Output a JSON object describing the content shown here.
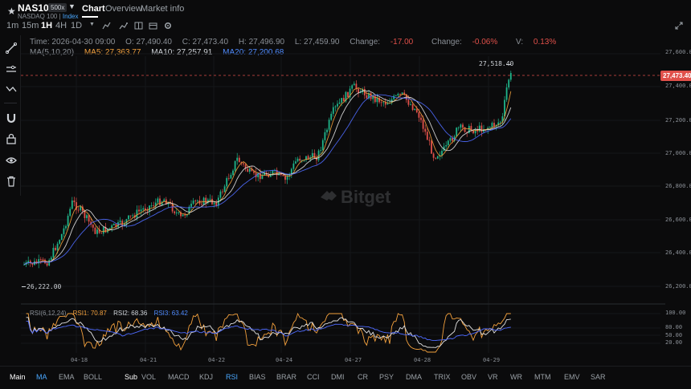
{
  "header": {
    "symbol": "NAS100",
    "leverage_badge": "500x",
    "subtitle": "NASDAQ 100",
    "subtitle_index": "Index",
    "tabs": [
      "Chart",
      "Overview",
      "Market info"
    ],
    "active_tab": "Chart"
  },
  "toolbar": {
    "timeframes": [
      "1m",
      "15m",
      "1H",
      "4H",
      "1D"
    ],
    "active_timeframe": "1H",
    "icons": [
      "chevron-down-icon",
      "indicator-icon",
      "compare-icon",
      "layout-icon",
      "calendar-icon",
      "settings-icon"
    ]
  },
  "ohlc": {
    "time": "Time: 2026-04-30 09:00",
    "open": "O: 27,490.40",
    "close": "C: 27,473.40",
    "high": "H: 27,496.90",
    "low": "L: 27,459.90",
    "change_label": "Change:",
    "change_value": "-17.00",
    "change_pct_label": "Change:",
    "change_pct_value": "-0.06%",
    "volatility_label": "V:",
    "volatility_value": "0.13%"
  },
  "ma": {
    "label": "MA(5,10,20)",
    "ma5": "MA5: 27,363.77",
    "ma10": "MA10: 27,257.91",
    "ma20": "MA20: 27,200.68"
  },
  "price_axis": [
    "27,600.00",
    "27,400.00",
    "27,200.00",
    "27,000.00",
    "26,800.00",
    "26,600.00",
    "26,400.00",
    "26,200.00"
  ],
  "current_price": "27,473.40",
  "high_marker": "27,518.40",
  "low_marker": "26,222.00",
  "watermark": "Bitget",
  "rsi": {
    "label": "RSI(6,12,24)",
    "rsi1": "RSI1: 70.87",
    "rsi2": "RSI2: 68.36",
    "rsi3": "RSI3: 63.42",
    "axis": [
      "100.00",
      "80.00",
      "50.00",
      "20.00"
    ]
  },
  "dates": [
    "04-18",
    "04-21",
    "04-22",
    "04-24",
    "04-27",
    "04-28",
    "04-29"
  ],
  "bottom": {
    "main_label": "Main",
    "main_items": [
      "MA",
      "EMA",
      "BOLL"
    ],
    "sub_label": "Sub",
    "sub_items": [
      "VOL",
      "MACD",
      "KDJ",
      "RSI",
      "BIAS",
      "BRAR",
      "CCI",
      "DMI",
      "CR",
      "PSY",
      "DMA",
      "TRIX",
      "OBV",
      "VR",
      "WR",
      "MTM",
      "EMV",
      "SAR"
    ]
  },
  "colors": {
    "up": "#1fb58a",
    "down": "#e0504a",
    "ma5": "#f2a03d",
    "ma10": "#e2e2e2",
    "ma20": "#4f6bff",
    "rsi1": "#f2a03d",
    "rsi2": "#e2e2e2",
    "rsi3": "#4f6bff"
  }
}
